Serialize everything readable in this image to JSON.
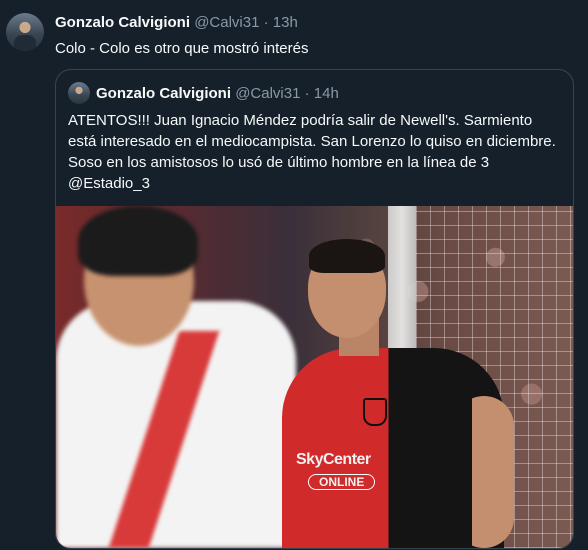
{
  "tweet": {
    "name": "Gonzalo Calvigioni",
    "handle": "@Calvi31",
    "separator": "·",
    "time": "13h",
    "text": "Colo - Colo es otro que mostró interés"
  },
  "quote": {
    "name": "Gonzalo Calvigioni",
    "handle": "@Calvi31",
    "separator": "·",
    "time": "14h",
    "text": "ATENTOS!!! Juan Ignacio Méndez podría salir de Newell's. Sarmiento está interesado en el mediocampista. San Lorenzo lo quiso en diciembre. Soso en los amistosos lo usó de último hombre en la línea de 3 @Estadio_3"
  },
  "photo": {
    "sponsor_main": "SkyCenter",
    "sponsor_sub": "ONLINE"
  }
}
